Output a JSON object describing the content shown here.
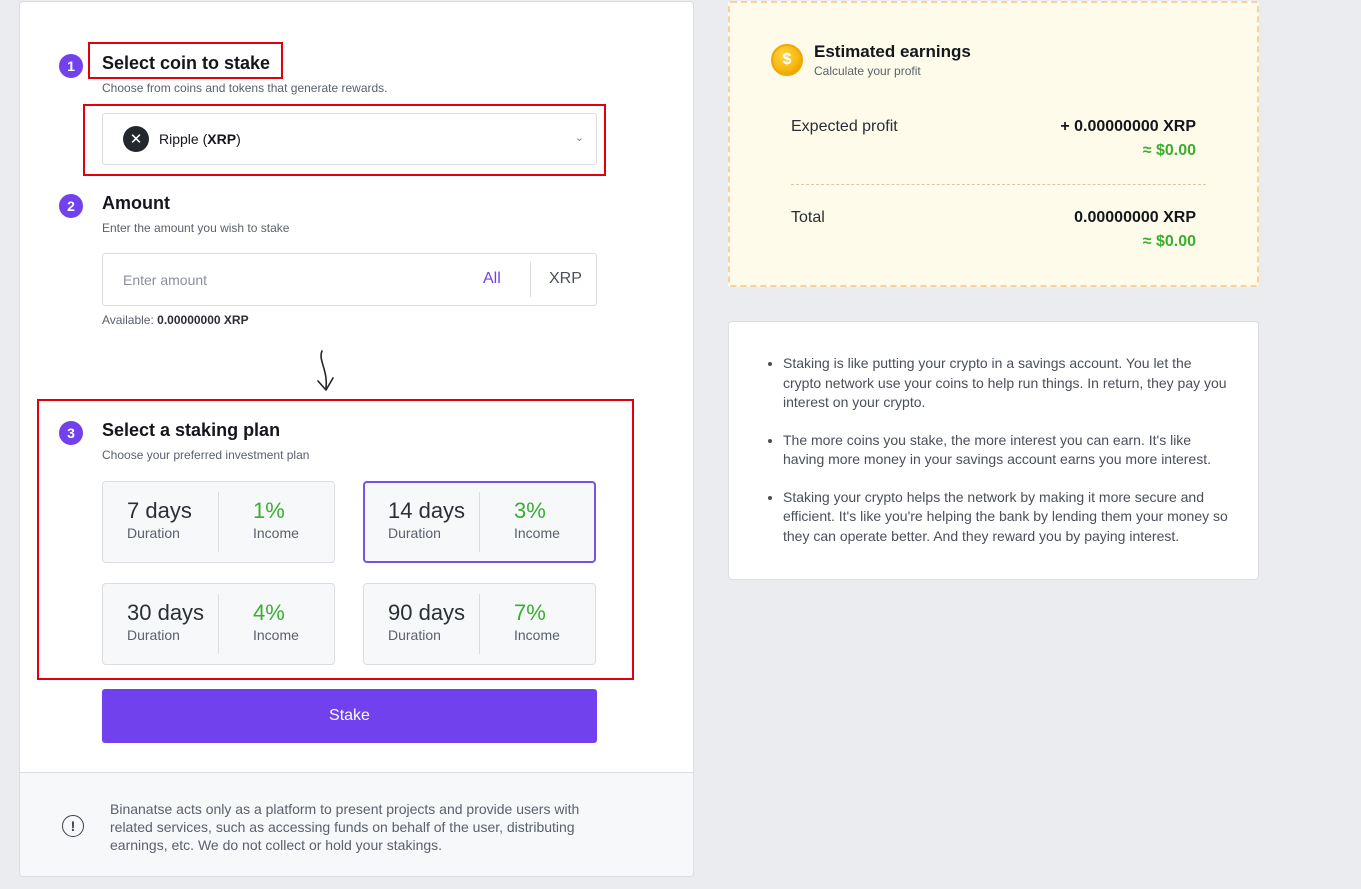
{
  "steps": {
    "coin": {
      "number": "1",
      "title": "Select coin to stake",
      "subtitle": "Choose from coins and tokens that generate rewards.",
      "selected_coin": {
        "name": "Ripple",
        "symbol": "XRP",
        "icon": "xrp-logo"
      }
    },
    "amount": {
      "number": "2",
      "title": "Amount",
      "subtitle": "Enter the amount you wish to stake",
      "placeholder": "Enter amount",
      "all_label": "All",
      "unit": "XRP",
      "available_label": "Available:",
      "available_value": "0.00000000 XRP"
    },
    "plan": {
      "number": "3",
      "title": "Select a staking plan",
      "subtitle": "Choose your preferred investment plan",
      "duration_label": "Duration",
      "income_label": "Income",
      "options": [
        {
          "days": "7 days",
          "income": "1%"
        },
        {
          "days": "14 days",
          "income": "3%"
        },
        {
          "days": "30 days",
          "income": "4%"
        },
        {
          "days": "90 days",
          "income": "7%"
        }
      ],
      "selected_index": 1
    }
  },
  "stake_button": "Stake",
  "disclaimer": "Binanatse acts only as a platform to present projects and provide users with related services, such as accessing funds on behalf of the user, distributing earnings, etc. We do not collect or hold your stakings.",
  "earnings": {
    "title": "Estimated earnings",
    "subtitle": "Calculate your profit",
    "expected_label": "Expected profit",
    "expected_value": "+ 0.00000000 XRP",
    "expected_usd": "≈ $0.00",
    "total_label": "Total",
    "total_value": "0.00000000 XRP",
    "total_usd": "≈ $0.00"
  },
  "info_points": [
    "Staking is like putting your crypto in a savings account. You let the crypto network use your coins to help run things. In return, they pay you interest on your crypto.",
    "The more coins you stake, the more interest you can earn. It's like having more money in your savings account earns you more interest.",
    "Staking your crypto helps the network by making it more secure and efficient. It's like you're helping the bank by lending them your money so they can operate better. And they reward you by paying interest."
  ],
  "colors": {
    "accent": "#7041ec",
    "positive": "#39ae2f",
    "highlight": "#e0000e",
    "earnings_bg": "#fffbea"
  }
}
